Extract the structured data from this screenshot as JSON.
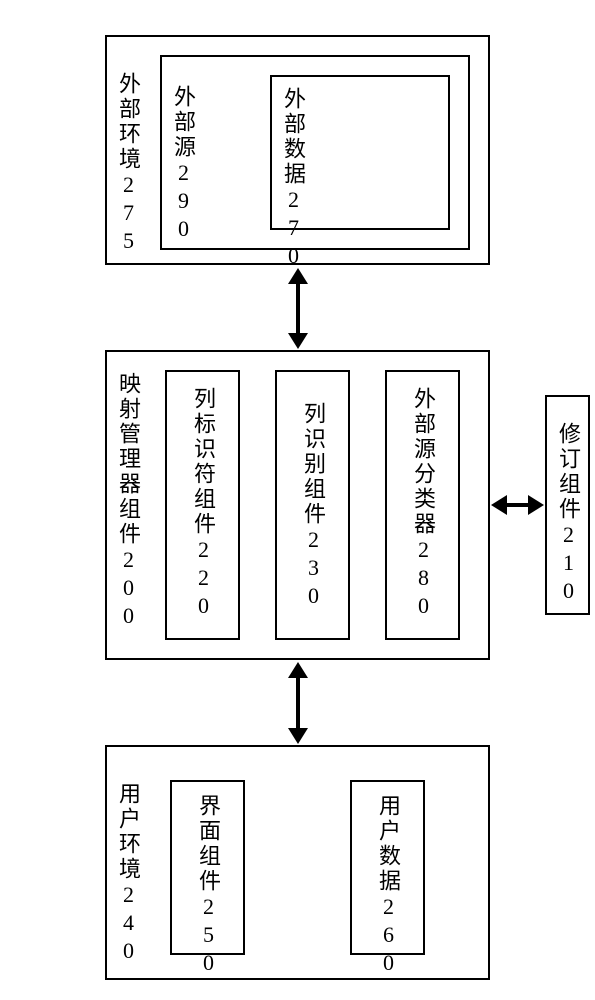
{
  "boxes": {
    "external_env": "外部环境275",
    "external_source": "外部源290",
    "external_data": "外部数据270",
    "mapping_manager": "映射管理器组件200",
    "col_identifier": "列标识符组件220",
    "col_recognition": "列识别组件230",
    "ext_source_classifier": "外部源分类器280",
    "revision": "修订组件210",
    "user_env": "用户环境240",
    "interface": "界面组件250",
    "user_data": "用户数据260"
  }
}
